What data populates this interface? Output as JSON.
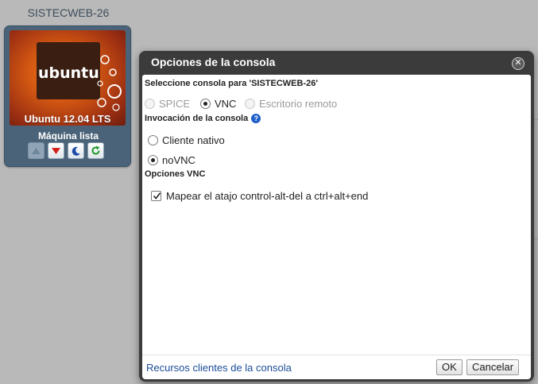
{
  "vm": {
    "name": "SISTECWEB-26",
    "logo_text": "ubuntu",
    "os_label": "Ubuntu 12.04 LTS",
    "status": "Máquina lista",
    "actions": [
      {
        "icon": "up-arrow-icon",
        "enabled": false
      },
      {
        "icon": "down-arrow-icon",
        "enabled": true
      },
      {
        "icon": "moon-icon",
        "enabled": true
      },
      {
        "icon": "refresh-icon",
        "enabled": true
      }
    ]
  },
  "dialog": {
    "title": "Opciones de la consola",
    "select_label": "Seleccione consola para 'SISTECWEB-26'",
    "console_types": [
      {
        "label": "SPICE",
        "checked": false,
        "disabled": true
      },
      {
        "label": "VNC",
        "checked": true,
        "disabled": false
      },
      {
        "label": "Escritorio remoto",
        "checked": false,
        "disabled": true
      }
    ],
    "invocation_label": "Invocación de la consola",
    "invocation_options": [
      {
        "label": "Cliente nativo",
        "checked": false
      },
      {
        "label": "noVNC",
        "checked": true
      }
    ],
    "vnc_options_label": "Opciones VNC",
    "ctrl_alt_del": {
      "label": "Mapear el atajo control-alt-del a ctrl+alt+end",
      "checked": true
    },
    "footer": {
      "link": "Recursos clientes de la consola",
      "ok": "OK",
      "cancel": "Cancelar"
    }
  },
  "colors": {
    "dialog_frame": "#3b3b3b",
    "link": "#1a4c99",
    "help_icon": "#1f5fc8",
    "vm_card": "#4a6378"
  }
}
